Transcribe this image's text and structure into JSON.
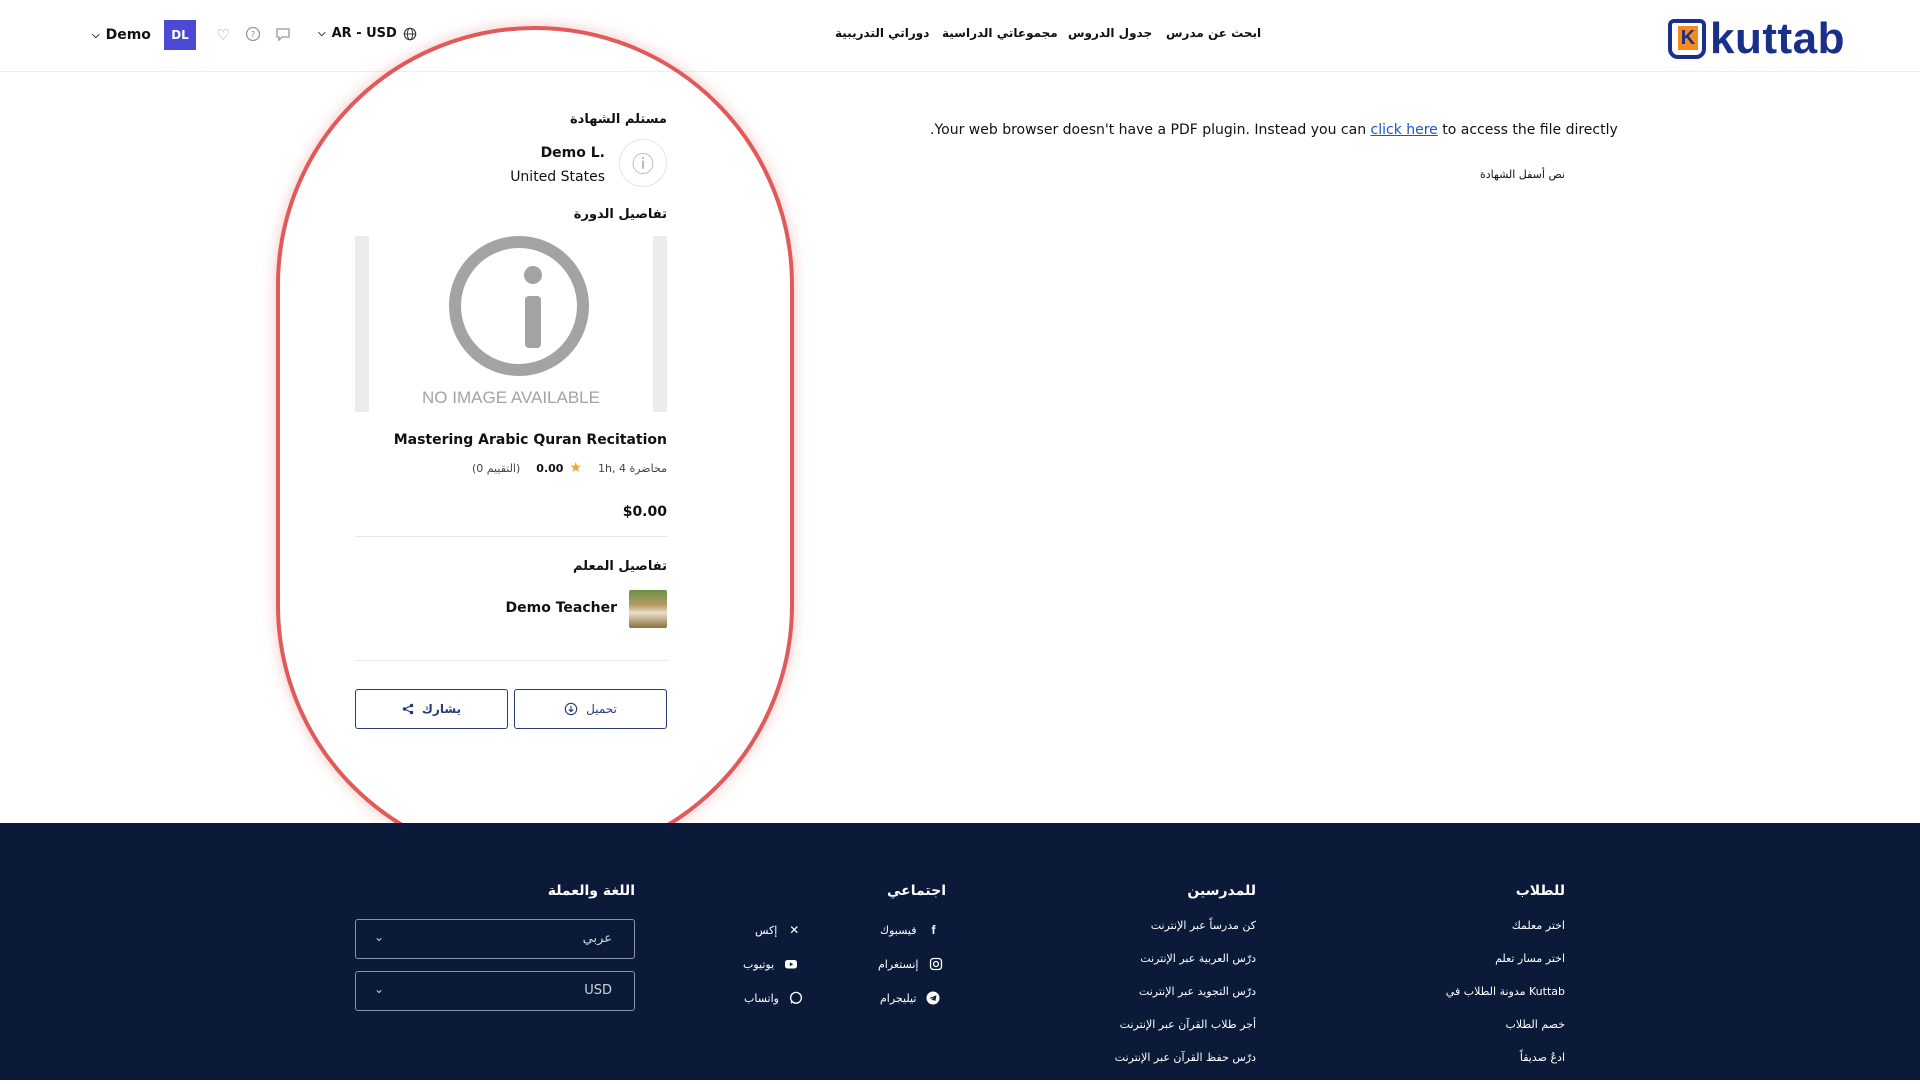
{
  "header": {
    "logo_text": "kuttab",
    "logo_letter": "K",
    "nav": [
      "ابحث عن مدرس",
      "جدول الدروس",
      "مجموعاتي الدراسية",
      "دوراتي التدريبية"
    ],
    "user_name": "Demo",
    "avatar_initials": "DL",
    "lang_currency": "AR - USD"
  },
  "main": {
    "pdf_message_before": ".Your web browser doesn't have a PDF plugin. Instead you can ",
    "pdf_link": "click here",
    "pdf_message_after": " to access the file directly",
    "certificate_footnote": "نص أسفل الشهادة"
  },
  "sidebar": {
    "recipient_title": "مستلم الشهادة",
    "recipient_name": "Demo L.",
    "recipient_country": "United States",
    "course_title_heading": "تفاصيل الدورة",
    "no_image_text": "NO IMAGE AVAILABLE",
    "course_name": "Mastering Arabic Quran Recitation",
    "course_duration": "1h, 4 محاضرة",
    "rating_value": "0.00",
    "rating_count": "(0 التقييم)",
    "price": "$0.00",
    "teacher_heading": "تفاصيل المعلم",
    "teacher_name": "Demo Teacher",
    "download_label": "تحميل",
    "share_label": "يشارك"
  },
  "footer": {
    "students_title": "للطلاب",
    "students_links": [
      "اختر معلمك",
      "اختر مسار تعلم",
      "مدونة الطلاب في Kuttab",
      "خصم الطلاب",
      "ادعُ صديقاً"
    ],
    "teachers_title": "للمدرسين",
    "teachers_links": [
      "كن مدرساً عبر الإنترنت",
      "درّس العربية عبر الإنترنت",
      "درّس التجويد عبر الإنترنت",
      "أجر طلاب القرآن عبر الإنترنت",
      "درّس حفظ القرآن عبر الإنترنت"
    ],
    "social_title": "اجتماعي",
    "social": {
      "facebook": "فيسبوك",
      "x": "إكس",
      "instagram": "إنستغرام",
      "youtube": "يوتيوب",
      "telegram": "تيليجرام",
      "whatsapp": "واتساب"
    },
    "lang_title": "اللغة والعملة",
    "language_value": "عربي",
    "currency_value": "USD"
  },
  "colors": {
    "brand": "#1a2f8a",
    "brand_accent": "#f58a1f",
    "footer_bg": "#0b1a38",
    "avatar_bg": "#4a4ad6",
    "highlight": "#e05a5a",
    "star": "#f5a623"
  }
}
